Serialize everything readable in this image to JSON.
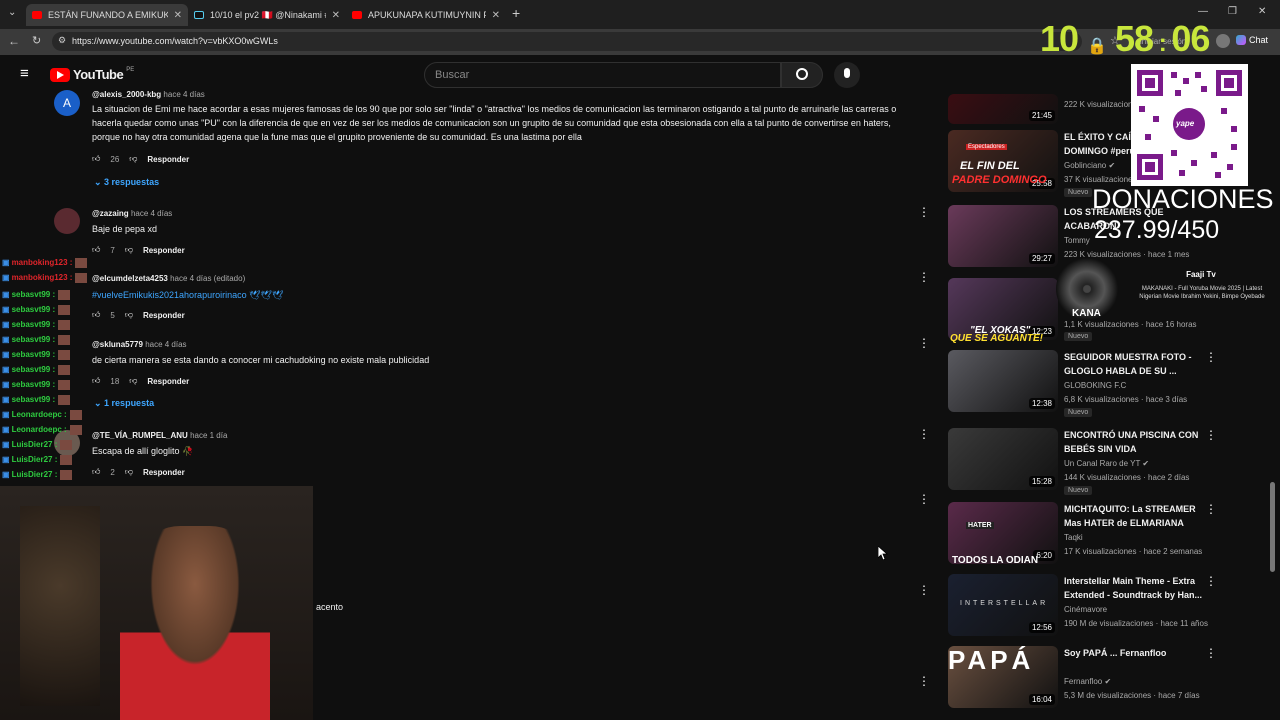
{
  "tabs": [
    {
      "label": "ESTÁN FUNANDO A EMIKUKIS DE"
    },
    {
      "label": "10/10 el pv2 🇵🇪 @Ninakami #anim"
    },
    {
      "label": "APUKUNAPA KUTIMUYNIN PV2 - E"
    }
  ],
  "url": "https://www.youtube.com/watch?v=vbKXO0wGWLs",
  "logo": "YouTube",
  "logo_region": "PE",
  "search_placeholder": "Buscar",
  "chrome_right": {
    "signin": "iniciar sesión",
    "chat": "Chat"
  },
  "comments": [
    {
      "user": "@alexis_2000-kbg",
      "time": "hace 4 días",
      "avatar": "A",
      "text": [
        "La situacion de Emi me hace acordar a esas mujeres famosas de los 90 que por solo ser \"linda\" o \"atractiva\" los medios de comunicacion las terminaron ostigando a  tal punto de arruinarle las carreras o",
        "hacerla quedar como unas \"PU\" con la diferencia de que en vez de ser los medios de comunicacion son un grupito de su comunidad que esta obsesionada con ella a tal punto de convertirse en haters,",
        "porque no hay otra comunidad agena que la fune mas que el grupito proveniente de su comunidad. Es una lastima por ella"
      ],
      "likes": "26",
      "reply": "Responder",
      "replies": "3 respuestas"
    },
    {
      "user": "@zazaing",
      "time": "hace 4 días",
      "text": [
        "Baje de pepa xd"
      ],
      "likes": "7",
      "reply": "Responder"
    },
    {
      "user": "@elcumdelzeta4253",
      "time": "hace 4 días (editado)",
      "text": [
        "#vuelveEmikukis2021ahorapuroirinaco 🕊🕊🕊"
      ],
      "likes": "5",
      "reply": "Responder"
    },
    {
      "user": "@skluna5779",
      "time": "hace 4 días",
      "text": [
        "de cierta manera se esta dando a conocer mi cachudoking no existe mala publicidad"
      ],
      "likes": "18",
      "reply": "Responder",
      "replies": "1 respuesta"
    },
    {
      "user": "@TE_VÍA_RUMPEL_ANU",
      "time": "hace 1 día",
      "text": [
        "Escapa de allí gloglito 🥀"
      ],
      "likes": "2",
      "reply": "Responder"
    }
  ],
  "partial_text": "acento",
  "chat": [
    {
      "name": "manboking123 :",
      "color": "#e0252b"
    },
    {
      "name": "manboking123 :",
      "color": "#e0252b"
    },
    {
      "name": "sebasvt99 :",
      "color": "#2ecc40"
    },
    {
      "name": "sebasvt99 :",
      "color": "#2ecc40"
    },
    {
      "name": "sebasvt99 :",
      "color": "#2ecc40"
    },
    {
      "name": "sebasvt99 :",
      "color": "#2ecc40"
    },
    {
      "name": "sebasvt99 :",
      "color": "#2ecc40"
    },
    {
      "name": "sebasvt99 :",
      "color": "#2ecc40"
    },
    {
      "name": "sebasvt99 :",
      "color": "#2ecc40"
    },
    {
      "name": "sebasvt99 :",
      "color": "#2ecc40"
    },
    {
      "name": "Leonardoepc :",
      "color": "#2ecc40"
    },
    {
      "name": "Leonardoepc :",
      "color": "#2ecc40"
    },
    {
      "name": "LuisDier27 :",
      "color": "#2ecc40"
    },
    {
      "name": "LuisDier27 :",
      "color": "#2ecc40"
    },
    {
      "name": "LuisDier27 :",
      "color": "#2ecc40"
    }
  ],
  "videos": [
    {
      "title": "",
      "channel": "",
      "meta": "222 K visualizaciones",
      "duration": "21:45",
      "thumb": "#3a0d12"
    },
    {
      "title": "EL ÉXITO Y CAÍDA DE DOMINGO #peru",
      "channel": "Goblinciano ✔",
      "meta": "37 K visualizaciones",
      "badge": "Nuevo",
      "duration": "25:58",
      "thumb": "#4a2a22"
    },
    {
      "title": "LOS STREAMERS QUE ACABARON",
      "channel": "Tommy",
      "meta": "223 K visualizaciones · hace 1 mes",
      "duration": "29:27",
      "thumb": "#6a3a5a"
    },
    {
      "title": "",
      "channel": "",
      "meta": "1,1 K visualizaciones · hace 16 horas",
      "badge": "Nuevo",
      "duration": "12:23",
      "thumb": "#55385a"
    },
    {
      "title": "SEGUIDOR MUESTRA FOTO - GLOGLO HABLA DE SU ...",
      "channel": "GLOBOKING F.C",
      "meta": "6,8 K visualizaciones · hace 3 días",
      "badge": "Nuevo",
      "duration": "12:38",
      "thumb": "#5a5a60"
    },
    {
      "title": "ENCONTRÓ UNA PISCINA CON BEBÉS SIN VIDA",
      "channel": "Un Canal Raro de YT ✔",
      "meta": "144 K visualizaciones · hace 2 días",
      "badge": "Nuevo",
      "duration": "15:28",
      "thumb": "#3a3a3a"
    },
    {
      "title": "MICHTAQUITO: La STREAMER Mas HATER de ELMARIANA",
      "channel": "Taqki",
      "meta": "17 K visualizaciones · hace 2 semanas",
      "duration": "6:20",
      "thumb": "#5a2a4a"
    },
    {
      "title": "Interstellar Main Theme - Extra Extended - Soundtrack by  Han...",
      "channel": "Cinémavore",
      "meta": "190 M de visualizaciones · hace 11 años",
      "duration": "12:56",
      "thumb": "#1a2030"
    },
    {
      "title": "Soy PAPÁ ... Fernanfloo",
      "channel": "Fernanfloo ✔",
      "meta": "5,3 M de visualizaciones · hace 7 días",
      "duration": "16:04",
      "thumb": "#6a5040"
    }
  ],
  "thumb_text": {
    "t1": "EL FIN DEL",
    "t2": "PADRE DOMINGO",
    "t3": "\"EL XOKAS\"",
    "t4": "QUE SE AGUANTE!",
    "t5": "TODOS LA ODIAN",
    "t6": "INTERSTELLAR",
    "t7": "PAPÁ",
    "hater": "HATER",
    "spect": "Espectadores"
  },
  "timer": {
    "h": "10",
    "m": "58",
    "s": "06"
  },
  "donations": {
    "label": "DONACIONES",
    "amount": "237.99/450",
    "qr_label": "yape"
  },
  "now_playing": {
    "artist": "Faaji Tv",
    "song": "MAKANAKI - Full Yoruba Movie 2025 | Latest Nigerian Movie Ibrahim Yekini, Bimpe Oyebade",
    "overlay": "KANA"
  }
}
